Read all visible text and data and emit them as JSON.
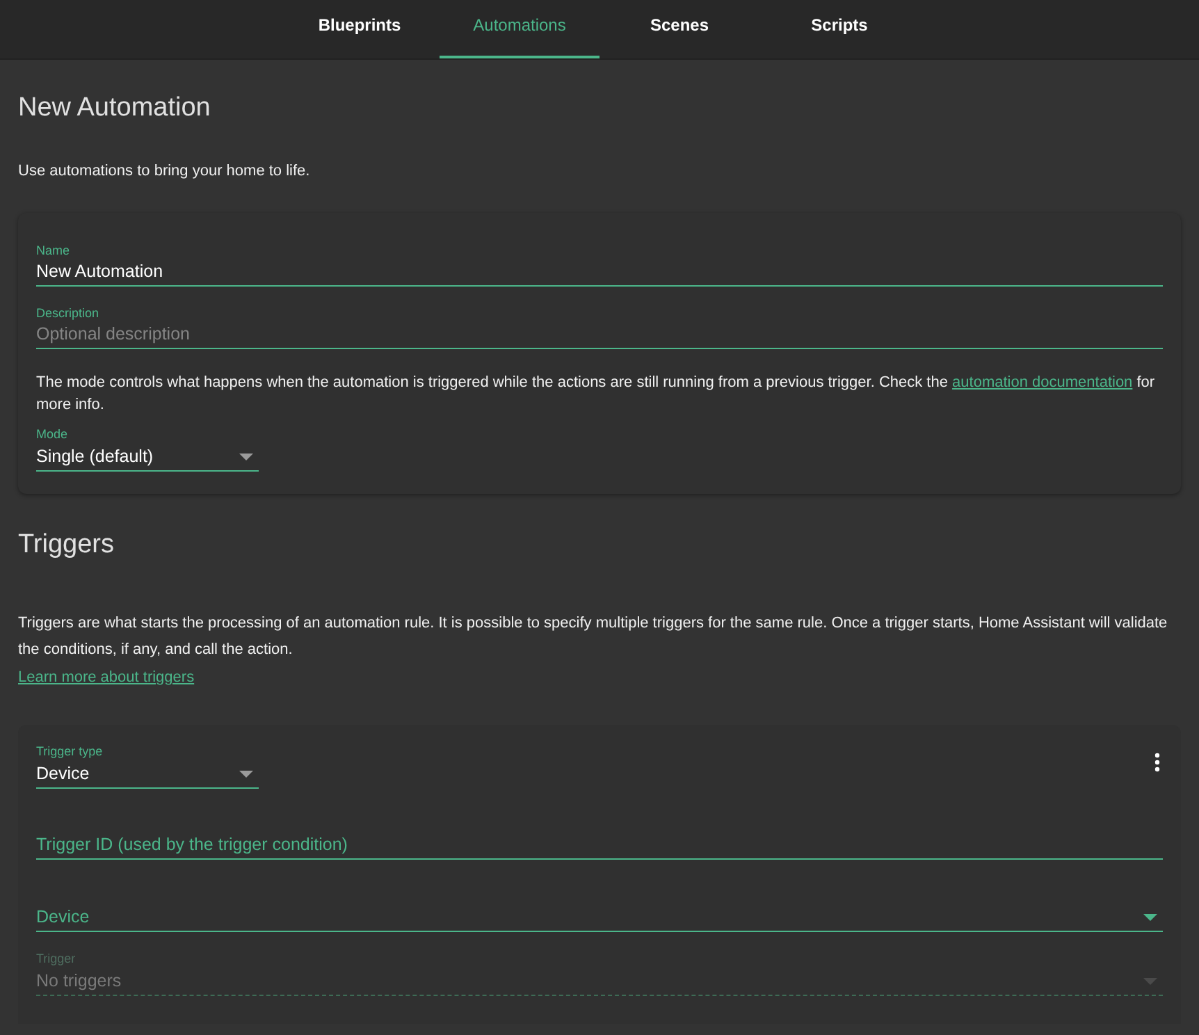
{
  "tabs": [
    {
      "label": "Blueprints",
      "selected": false
    },
    {
      "label": "Automations",
      "selected": true
    },
    {
      "label": "Scenes",
      "selected": false
    },
    {
      "label": "Scripts",
      "selected": false
    }
  ],
  "header": {
    "title": "New Automation",
    "description": "Use automations to bring your home to life."
  },
  "details_card": {
    "name": {
      "label": "Name",
      "value": "New Automation"
    },
    "description": {
      "label": "Description",
      "placeholder": "Optional description"
    },
    "mode_help": {
      "before": "The mode controls what happens when the automation is triggered while the actions are still running from a previous trigger. Check the ",
      "link": "automation documentation",
      "after": " for more info."
    },
    "mode": {
      "label": "Mode",
      "value": "Single (default)"
    }
  },
  "triggers": {
    "title": "Triggers",
    "description": "Triggers are what starts the processing of an automation rule. It is possible to specify multiple triggers for the same rule. Once a trigger starts, Home Assistant will validate the conditions, if any, and call the action.",
    "link": "Learn more about triggers",
    "card": {
      "trigger_type": {
        "label": "Trigger type",
        "value": "Device"
      },
      "trigger_id": {
        "placeholder": "Trigger ID (used by the trigger condition)"
      },
      "device": {
        "label": "Device",
        "disabled": false
      },
      "trigger": {
        "label": "Trigger",
        "value": "No triggers",
        "disabled": true
      }
    }
  }
}
